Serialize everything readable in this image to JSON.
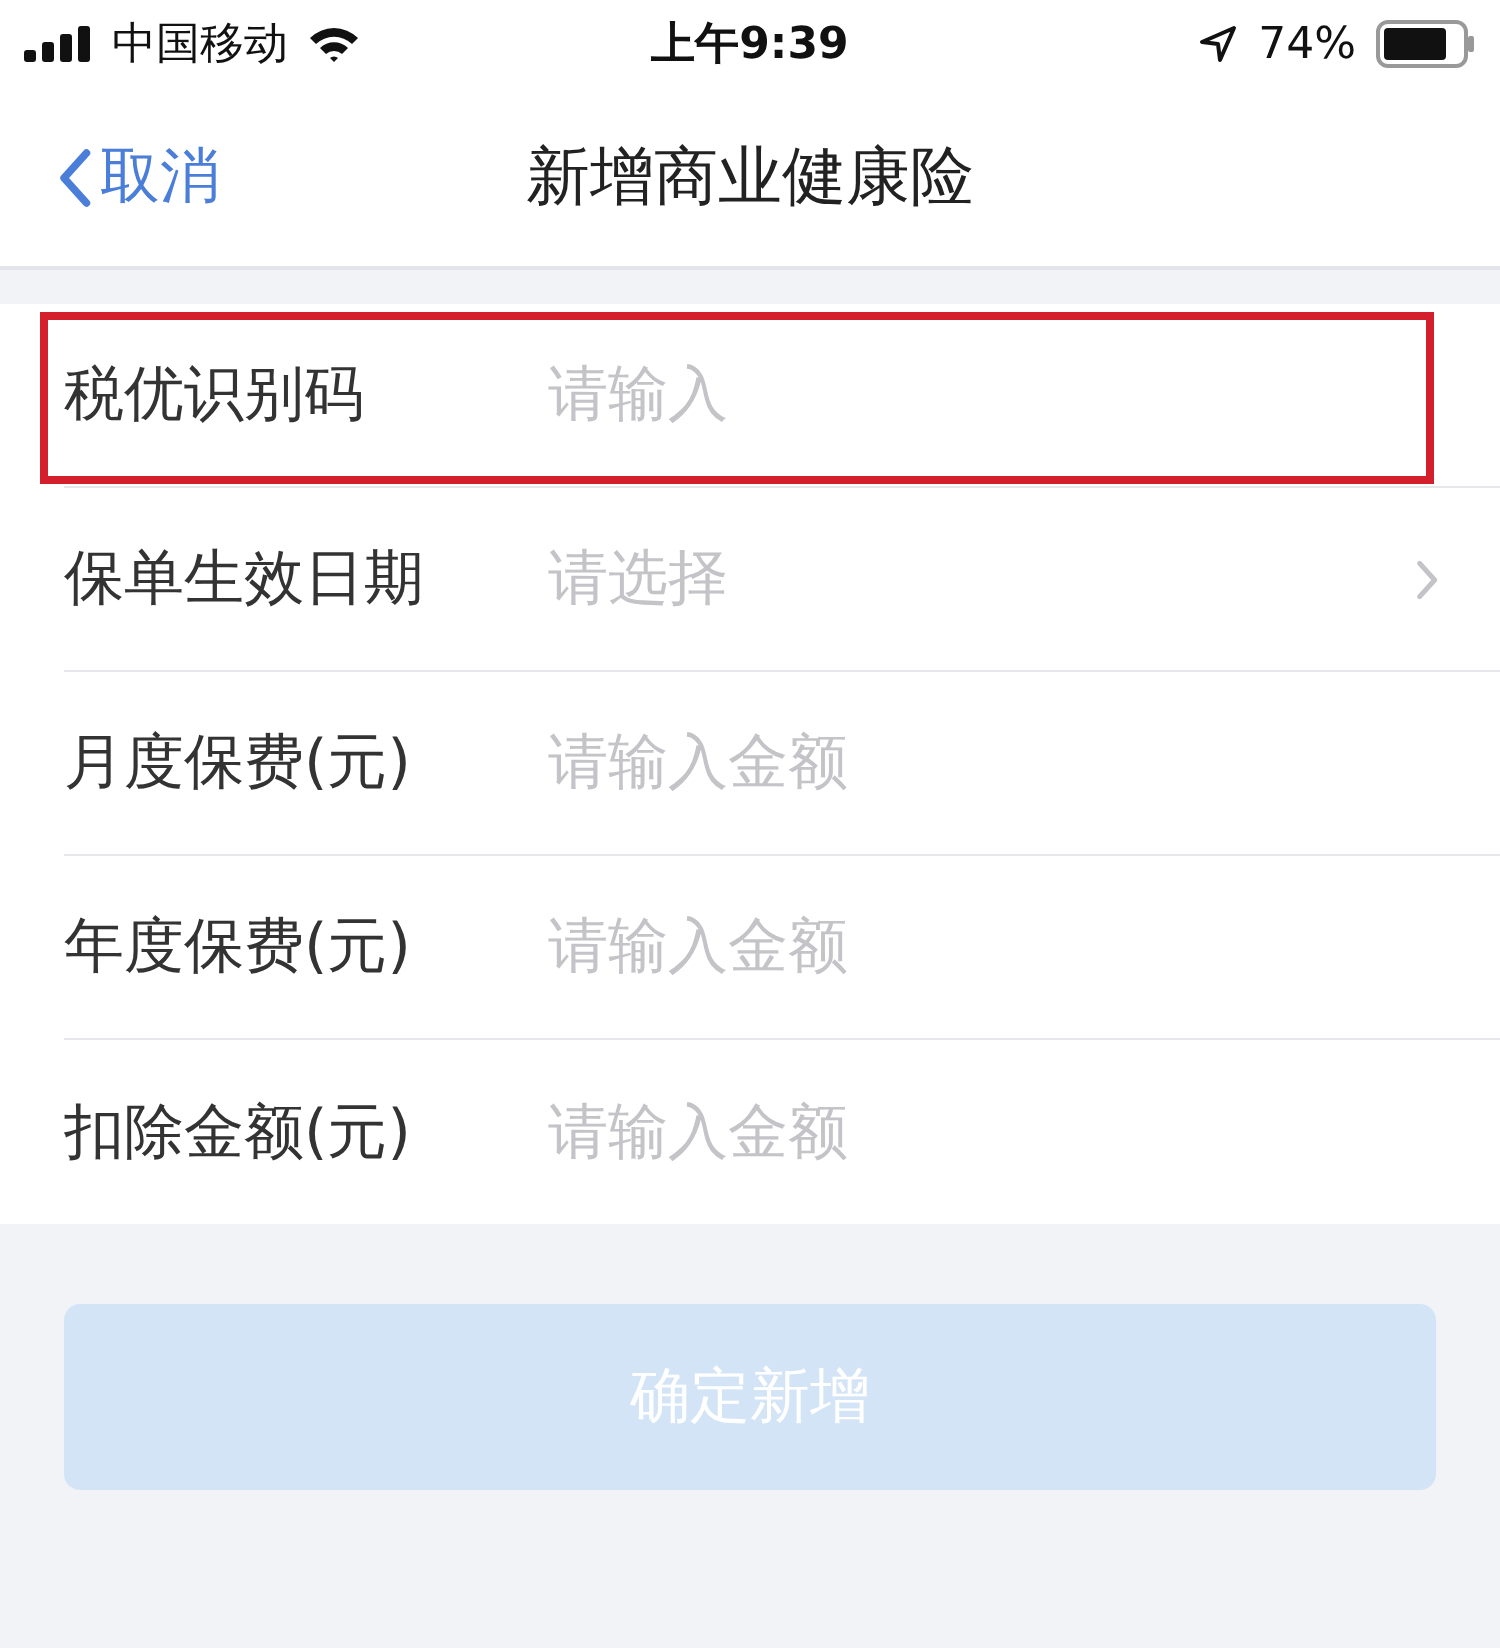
{
  "status_bar": {
    "carrier": "中国移动",
    "time": "上午9:39",
    "battery": "74%"
  },
  "nav": {
    "back": "取消",
    "title": "新增商业健康险"
  },
  "rows": [
    {
      "kind": "input",
      "label": "税优识别码",
      "placeholder": "请输入",
      "highlighted": true
    },
    {
      "kind": "select",
      "label": "保单生效日期",
      "placeholder": "请选择",
      "highlighted": false
    },
    {
      "kind": "input",
      "label": "月度保费(元)",
      "placeholder": "请输入金额",
      "highlighted": false
    },
    {
      "kind": "input",
      "label": "年度保费(元)",
      "placeholder": "请输入金额",
      "highlighted": false
    },
    {
      "kind": "input",
      "label": "扣除金额(元)",
      "placeholder": "请输入金额",
      "highlighted": false
    }
  ],
  "submit": {
    "label": "确定新增",
    "disabled": true
  }
}
